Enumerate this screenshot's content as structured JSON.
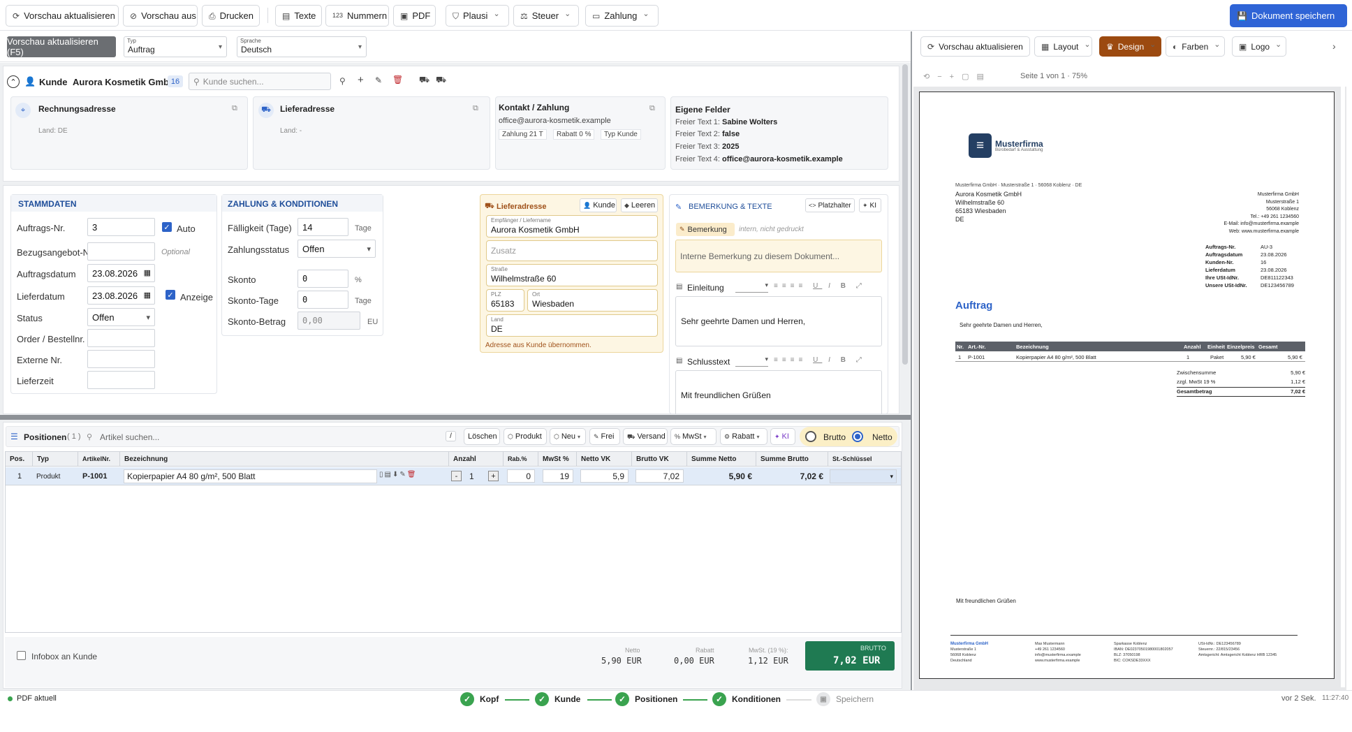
{
  "toolbar": {
    "refresh": "Vorschau aktualisieren",
    "preview_off": "Vorschau aus",
    "print": "Drucken",
    "texts": "Texte",
    "numbers": "Nummern",
    "pdf": "PDF",
    "plausi": "Plausi",
    "tax": "Steuer",
    "payment": "Zahlung",
    "save": "Dokument speichern"
  },
  "subbar": {
    "refresh_f5": "Vorschau aktualisieren (F5)",
    "type_label": "Typ",
    "type_value": "Auftrag",
    "lang_label": "Sprache",
    "lang_value": "Deutsch"
  },
  "customer": {
    "label": "Kunde",
    "name": "Aurora Kosmetik GmbH",
    "badge": "16",
    "search_placeholder": "Kunde suchen...",
    "billing_title": "Rechnungsadresse",
    "billing_country": "Land:  DE",
    "delivery_title": "Lieferadresse",
    "delivery_country": "Land:  -",
    "contact_title": "Kontakt / Zahlung",
    "contact_email": "office@aurora-kosmetik.example",
    "contact_pay": "Zahlung  21 T",
    "contact_discount": "Rabatt  0 %",
    "contact_type": "Typ  Kunde",
    "custom_title": "Eigene Felder",
    "custom": [
      {
        "k": "Freier Text 1:",
        "v": "Sabine Wolters"
      },
      {
        "k": "Freier Text 2:",
        "v": "false"
      },
      {
        "k": "Freier Text 3:",
        "v": "2025"
      },
      {
        "k": "Freier Text 4:",
        "v": "office@aurora-kosmetik.example"
      }
    ]
  },
  "stammdaten": {
    "title": "STAMMDATEN",
    "order_no_label": "Auftrags-Nr.",
    "order_no": "3",
    "auto": "Auto",
    "ref_label": "Bezugsangebot-Nr",
    "ref_placeholder": "Optional",
    "date_label": "Auftragsdatum",
    "date": "23.08.2026",
    "delivery_date_label": "Lieferdatum",
    "delivery_date": "23.08.2026",
    "show": "Anzeige",
    "status_label": "Status",
    "status": "Offen",
    "order_ref_label": "Order / Bestellnr.",
    "ext_no_label": "Externe Nr.",
    "delivery_time_label": "Lieferzeit"
  },
  "zahlung": {
    "title": "ZAHLUNG & KONDITIONEN",
    "due_label": "Fälligkeit (Tage)",
    "due": "14",
    "due_unit": "Tage",
    "status_label": "Zahlungsstatus",
    "status": "Offen",
    "skonto_label": "Skonto",
    "skonto": "0",
    "skonto_unit": "%",
    "skonto_days_label": "Skonto-Tage",
    "skonto_days": "0",
    "skonto_days_unit": "Tage",
    "skonto_amount_label": "Skonto-Betrag",
    "skonto_amount": "0,00",
    "skonto_amount_unit": "EU"
  },
  "lieferadresse": {
    "title": "Lieferadresse",
    "btn_customer": "Kunde",
    "btn_clear": "Leeren",
    "recipient_label": "Empfänger / Liefername",
    "recipient": "Aurora Kosmetik GmbH",
    "extra_placeholder": "Zusatz",
    "street_label": "Straße",
    "street": "Wilhelmstraße 60",
    "zip_label": "PLZ",
    "zip": "65183",
    "city_label": "Ort",
    "city": "Wiesbaden",
    "country_label": "Land",
    "country": "DE",
    "note": "Adresse aus Kunde übernommen."
  },
  "bemerkung": {
    "title": "BEMERKUNG & TEXTE",
    "placeholder_btn": "Platzhalter",
    "ai_btn": "KI",
    "tag": "Bemerkung",
    "tag_hint": "intern, nicht gedruckt",
    "internal_placeholder": "Interne Bemerkung zu diesem Dokument...",
    "intro_label": "Einleitung",
    "intro_text": "Sehr geehrte Damen und Herren,",
    "closing_label": "Schlusstext",
    "closing_text": "Mit freundlichen Grüßen"
  },
  "positions": {
    "title": "Positionen",
    "count": "( 1 )",
    "search_placeholder": "Artikel suchen...",
    "slash": "/",
    "delete": "Löschen",
    "product": "Produkt",
    "new": "Neu",
    "free": "Frei",
    "shipping": "Versand",
    "vat": "MwSt",
    "discount": "Rabatt",
    "ai": "KI",
    "gross": "Brutto",
    "net": "Netto",
    "headers": [
      "Pos.",
      "Typ",
      "ArtikelNr.",
      "Bezeichnung",
      "Anzahl",
      "Rab.%",
      "MwSt %",
      "Netto VK",
      "Brutto VK",
      "Summe Netto",
      "Summe Brutto",
      "St.-Schlüssel"
    ],
    "rows": [
      {
        "pos": "1",
        "type": "Produkt",
        "art": "P-1001",
        "desc": "Kopierpapier A4 80 g/m², 500 Blatt",
        "qty": "1",
        "discount": "0",
        "vat": "19",
        "net": "5,9",
        "gross": "7,02",
        "sum_net": "5,90 €",
        "sum_gross": "7,02 €"
      }
    ]
  },
  "footer": {
    "infobox": "Infobox an Kunde",
    "net_label": "Netto",
    "net": "5,90 EUR",
    "discount_label": "Rabatt",
    "discount": "0,00 EUR",
    "vat_label": "MwSt. (19 %):",
    "vat": "1,12 EUR",
    "gross_label": "BRUTTO",
    "gross": "7,02 EUR"
  },
  "preview": {
    "refresh": "Vorschau aktualisieren",
    "layout": "Layout",
    "design": "Design",
    "colors": "Farben",
    "logo": "Logo",
    "page": "Seite 1 von 1 · 75%",
    "company": "Musterfirma",
    "company_sub": "Bürobedarf & Ausstattung",
    "sender_line": "Musterfirma GmbH · Musterstraße 1 · 56068 Koblenz · DE",
    "recipient": [
      "Aurora Kosmetik GmbH",
      "Wilhelmstraße 60",
      "65183 Wiesbaden",
      "DE"
    ],
    "company_block": [
      "Musterfirma GmbH",
      "Musterstraße 1",
      "56068 Koblenz",
      "Tel.: +49 261 1234560",
      "E-Mail: info@musterfirma.example",
      "Web: www.musterfirma.example"
    ],
    "meta": [
      {
        "k": "Auftrags-Nr.",
        "v": "AU-3"
      },
      {
        "k": "Auftragsdatum",
        "v": "23.08.2026"
      },
      {
        "k": "Kunden-Nr.",
        "v": "16"
      },
      {
        "k": "Lieferdatum",
        "v": "23.08.2026"
      },
      {
        "k": "Ihre USt-IdNr.",
        "v": "DE811122343"
      },
      {
        "k": "Unsere USt-IdNr.",
        "v": "DE123456789"
      }
    ],
    "doc_title": "Auftrag",
    "greeting": "Sehr geehrte Damen und Herren,",
    "table_headers": [
      "Nr.",
      "Art.-Nr.",
      "Bezeichnung",
      "Anzahl",
      "Einheit",
      "Einzelpreis",
      "Gesamt"
    ],
    "table_row": [
      "1",
      "P-1001",
      "Kopierpapier A4 80 g/m², 500 Blatt",
      "1",
      "Paket",
      "5,90 €",
      "5,90 €"
    ],
    "subtotal_label": "Zwischensumme",
    "subtotal": "5,90 €",
    "vat_label": "zzgl. MwSt 19 %",
    "vat": "1,12 €",
    "total_label": "Gesamtbetrag",
    "total": "7,02 €",
    "closing": "Mit freundlichen Grüßen",
    "foot_col1": [
      "Musterfirma GmbH",
      "Musterstraße 1",
      "56068 Koblenz",
      "Deutschland"
    ],
    "foot_col2": [
      "Max Mustermann",
      "+49 261 1234560",
      "info@musterfirma.example",
      "www.musterfirma.example"
    ],
    "foot_col3": [
      "Sparkasse Koblenz",
      "IBAN: DE02370501980001802057",
      "BLZ: 37050198",
      "BIC: COKSDE33XXX"
    ],
    "foot_col4": [
      "USt-IdNr.: DE123456789",
      "Steuernr.: 22/815/23456",
      "Amtsgericht: Amtsgericht Koblenz HRB 12345"
    ]
  },
  "status": {
    "pdf": "PDF aktuell",
    "steps": [
      "Kopf",
      "Kunde",
      "Positionen",
      "Konditionen",
      "Speichern"
    ],
    "saved": "vor 2 Sek.",
    "time": "11:27:40"
  },
  "colors": {
    "accent": "#2d63c8",
    "save": "#2f64d6",
    "design": "#9c4a10",
    "green": "#3aa34f",
    "gross_box": "#1f7a52"
  }
}
